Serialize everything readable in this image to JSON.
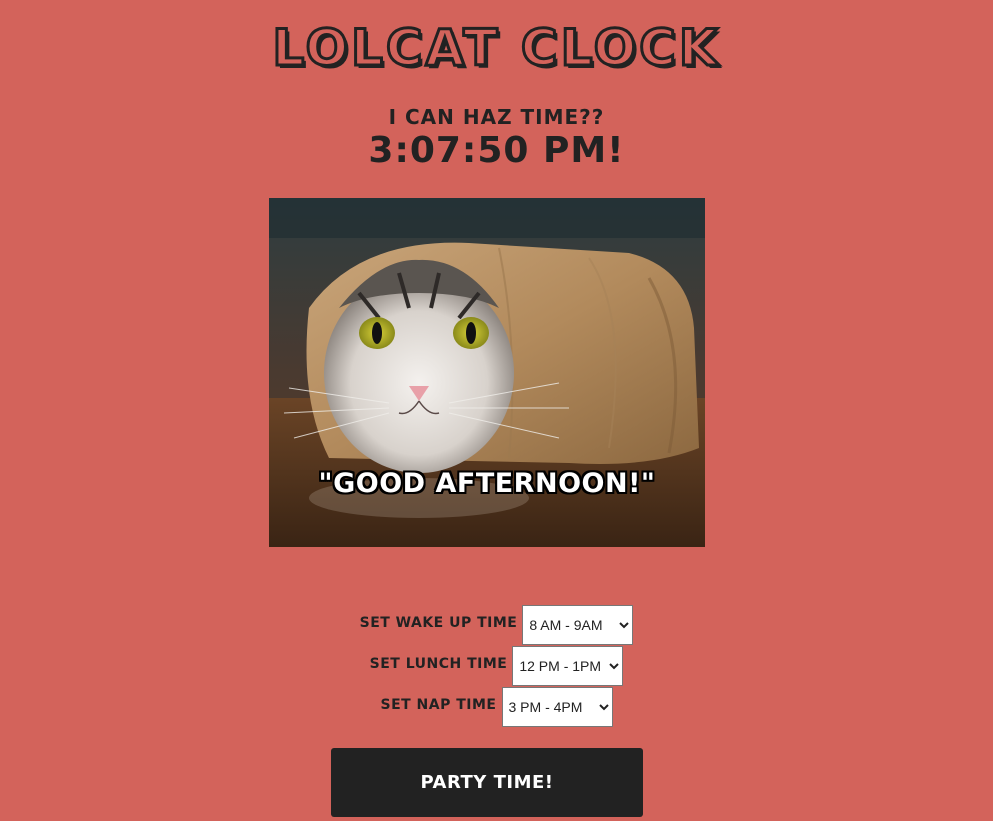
{
  "header": {
    "title": "Lolcat Clock"
  },
  "clock": {
    "label": "I can haz time??",
    "time": "3:07:50 PM!"
  },
  "photo": {
    "caption": "\"GOOD AFTERNOON!\""
  },
  "controls": {
    "wake": {
      "label": "Set wake up time",
      "selected": "8 AM - 9AM"
    },
    "lunch": {
      "label": "Set lunch time",
      "selected": "12 PM - 1PM"
    },
    "nap": {
      "label": "Set nap time",
      "selected": "3 PM - 4PM"
    }
  },
  "party_button": {
    "label": "Party Time!"
  },
  "colors": {
    "background": "#d3635b",
    "text": "#222222",
    "button": "#222222"
  }
}
